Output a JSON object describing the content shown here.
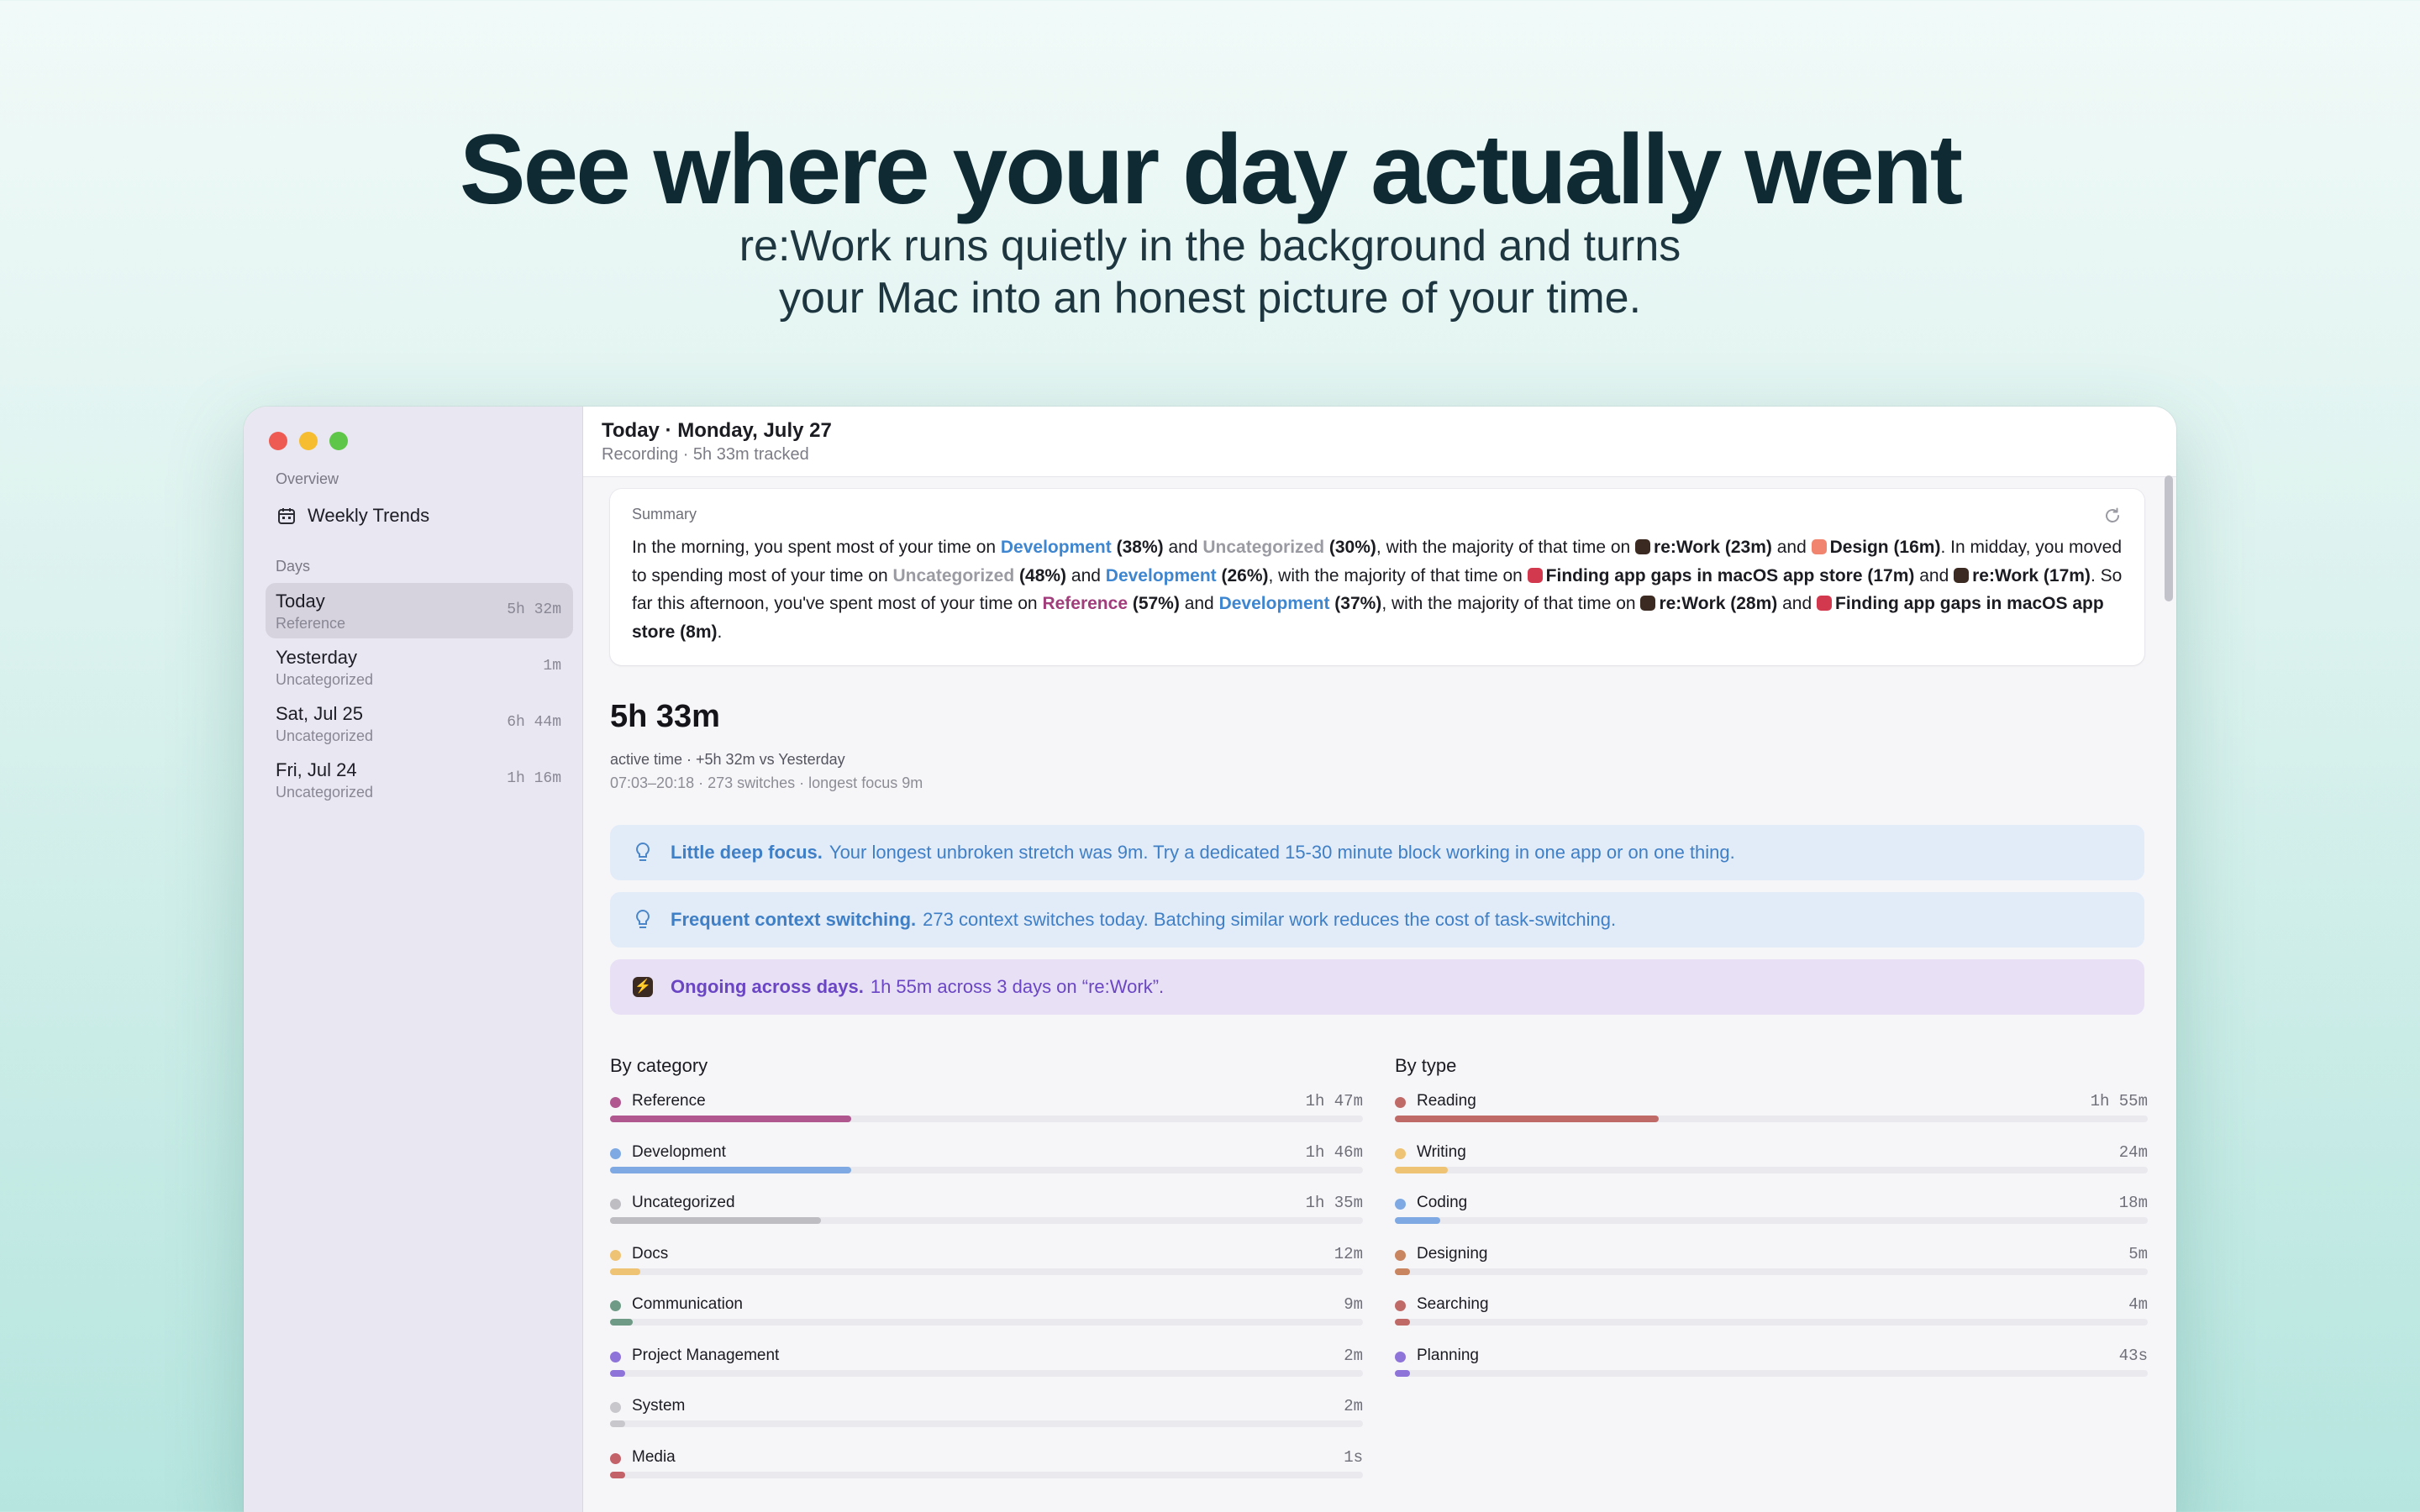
{
  "hero": {
    "title": "See where your day actually went",
    "subtitle_line1": "re:Work runs quietly in the background and turns",
    "subtitle_line2": "your Mac into an honest picture of your time."
  },
  "sidebar": {
    "overview_label": "Overview",
    "weekly_trends_label": "Weekly Trends",
    "days_label": "Days",
    "days": [
      {
        "name": "Today",
        "category": "Reference",
        "duration": "5h 32m",
        "active": true
      },
      {
        "name": "Yesterday",
        "category": "Uncategorized",
        "duration": "1m",
        "active": false
      },
      {
        "name": "Sat, Jul 25",
        "category": "Uncategorized",
        "duration": "6h 44m",
        "active": false
      },
      {
        "name": "Fri, Jul 24",
        "category": "Uncategorized",
        "duration": "1h 16m",
        "active": false
      }
    ]
  },
  "header": {
    "title": "Today · Monday, July 27",
    "subtitle": "Recording · 5h 33m tracked"
  },
  "summary": {
    "label": "Summary",
    "t1": "In the morning, you spent most of your time on ",
    "dev1": "Development",
    "p1": " (38%)",
    "t2": " and ",
    "unc1": "Uncategorized",
    "p2": " (30%)",
    "t3": ", with the majority of that time on ",
    "a1": "re:Work (23m)",
    "t4": " and ",
    "a2": "Design (16m)",
    "t5": ". In midday, you moved to spending most of your time on ",
    "unc2": "Uncategorized",
    "p3": " (48%)",
    "t6": " and ",
    "dev2": "Development",
    "p4": " (26%)",
    "t7": ", with the majority of that time on ",
    "a3": "Finding app gaps in macOS app store (17m)",
    "t8": " and ",
    "a4": "re:Work (17m)",
    "t9": ". So far this afternoon, you've spent most of your time on ",
    "ref1": "Reference",
    "p5": " (57%)",
    "t10": " and ",
    "dev3": "Development",
    "p6": " (37%)",
    "t11": ", with the majority of that time on ",
    "a5": "re:Work (28m)",
    "t12": " and ",
    "a6": "Finding app gaps in macOS app store (8m)",
    "t13": "."
  },
  "stats": {
    "total": "5h 33m",
    "line1": "active time · +5h 32m vs Yesterday",
    "line2": "07:03–20:18 · 273 switches · longest focus 9m"
  },
  "insights": [
    {
      "title": "Little deep focus.",
      "text": "Your longest unbroken stretch was 9m. Try a dedicated 15-30 minute block working in one app or on one thing."
    },
    {
      "title": "Frequent context switching.",
      "text": "273 context switches today. Batching similar work reduces the cost of task-switching."
    },
    {
      "title": "Ongoing across days.",
      "text": "1h 55m across 3 days on “re:Work”."
    }
  ],
  "by_category": {
    "title": "By category",
    "items": [
      {
        "label": "Reference",
        "duration": "1h 47m",
        "fraction": 0.32,
        "color": "#b0578f"
      },
      {
        "label": "Development",
        "duration": "1h 46m",
        "fraction": 0.32,
        "color": "#7fa9e3"
      },
      {
        "label": "Uncategorized",
        "duration": "1h 35m",
        "fraction": 0.28,
        "color": "#bdbdc2"
      },
      {
        "label": "Docs",
        "duration": "12m",
        "fraction": 0.04,
        "color": "#efc374"
      },
      {
        "label": "Communication",
        "duration": "9m",
        "fraction": 0.03,
        "color": "#6f9a86"
      },
      {
        "label": "Project Management",
        "duration": "2m",
        "fraction": 0.02,
        "color": "#8e73d8"
      },
      {
        "label": "System",
        "duration": "2m",
        "fraction": 0.02,
        "color": "#c7c7cc"
      },
      {
        "label": "Media",
        "duration": "1s",
        "fraction": 0.02,
        "color": "#c4626a"
      }
    ]
  },
  "by_type": {
    "title": "By type",
    "items": [
      {
        "label": "Reading",
        "duration": "1h 55m",
        "fraction": 0.35,
        "color": "#c06a68"
      },
      {
        "label": "Writing",
        "duration": "24m",
        "fraction": 0.07,
        "color": "#efc374"
      },
      {
        "label": "Coding",
        "duration": "18m",
        "fraction": 0.06,
        "color": "#7fa9e3"
      },
      {
        "label": "Designing",
        "duration": "5m",
        "fraction": 0.02,
        "color": "#c98460"
      },
      {
        "label": "Searching",
        "duration": "4m",
        "fraction": 0.02,
        "color": "#c06a68"
      },
      {
        "label": "Planning",
        "duration": "43s",
        "fraction": 0.02,
        "color": "#8e73d8"
      }
    ]
  }
}
